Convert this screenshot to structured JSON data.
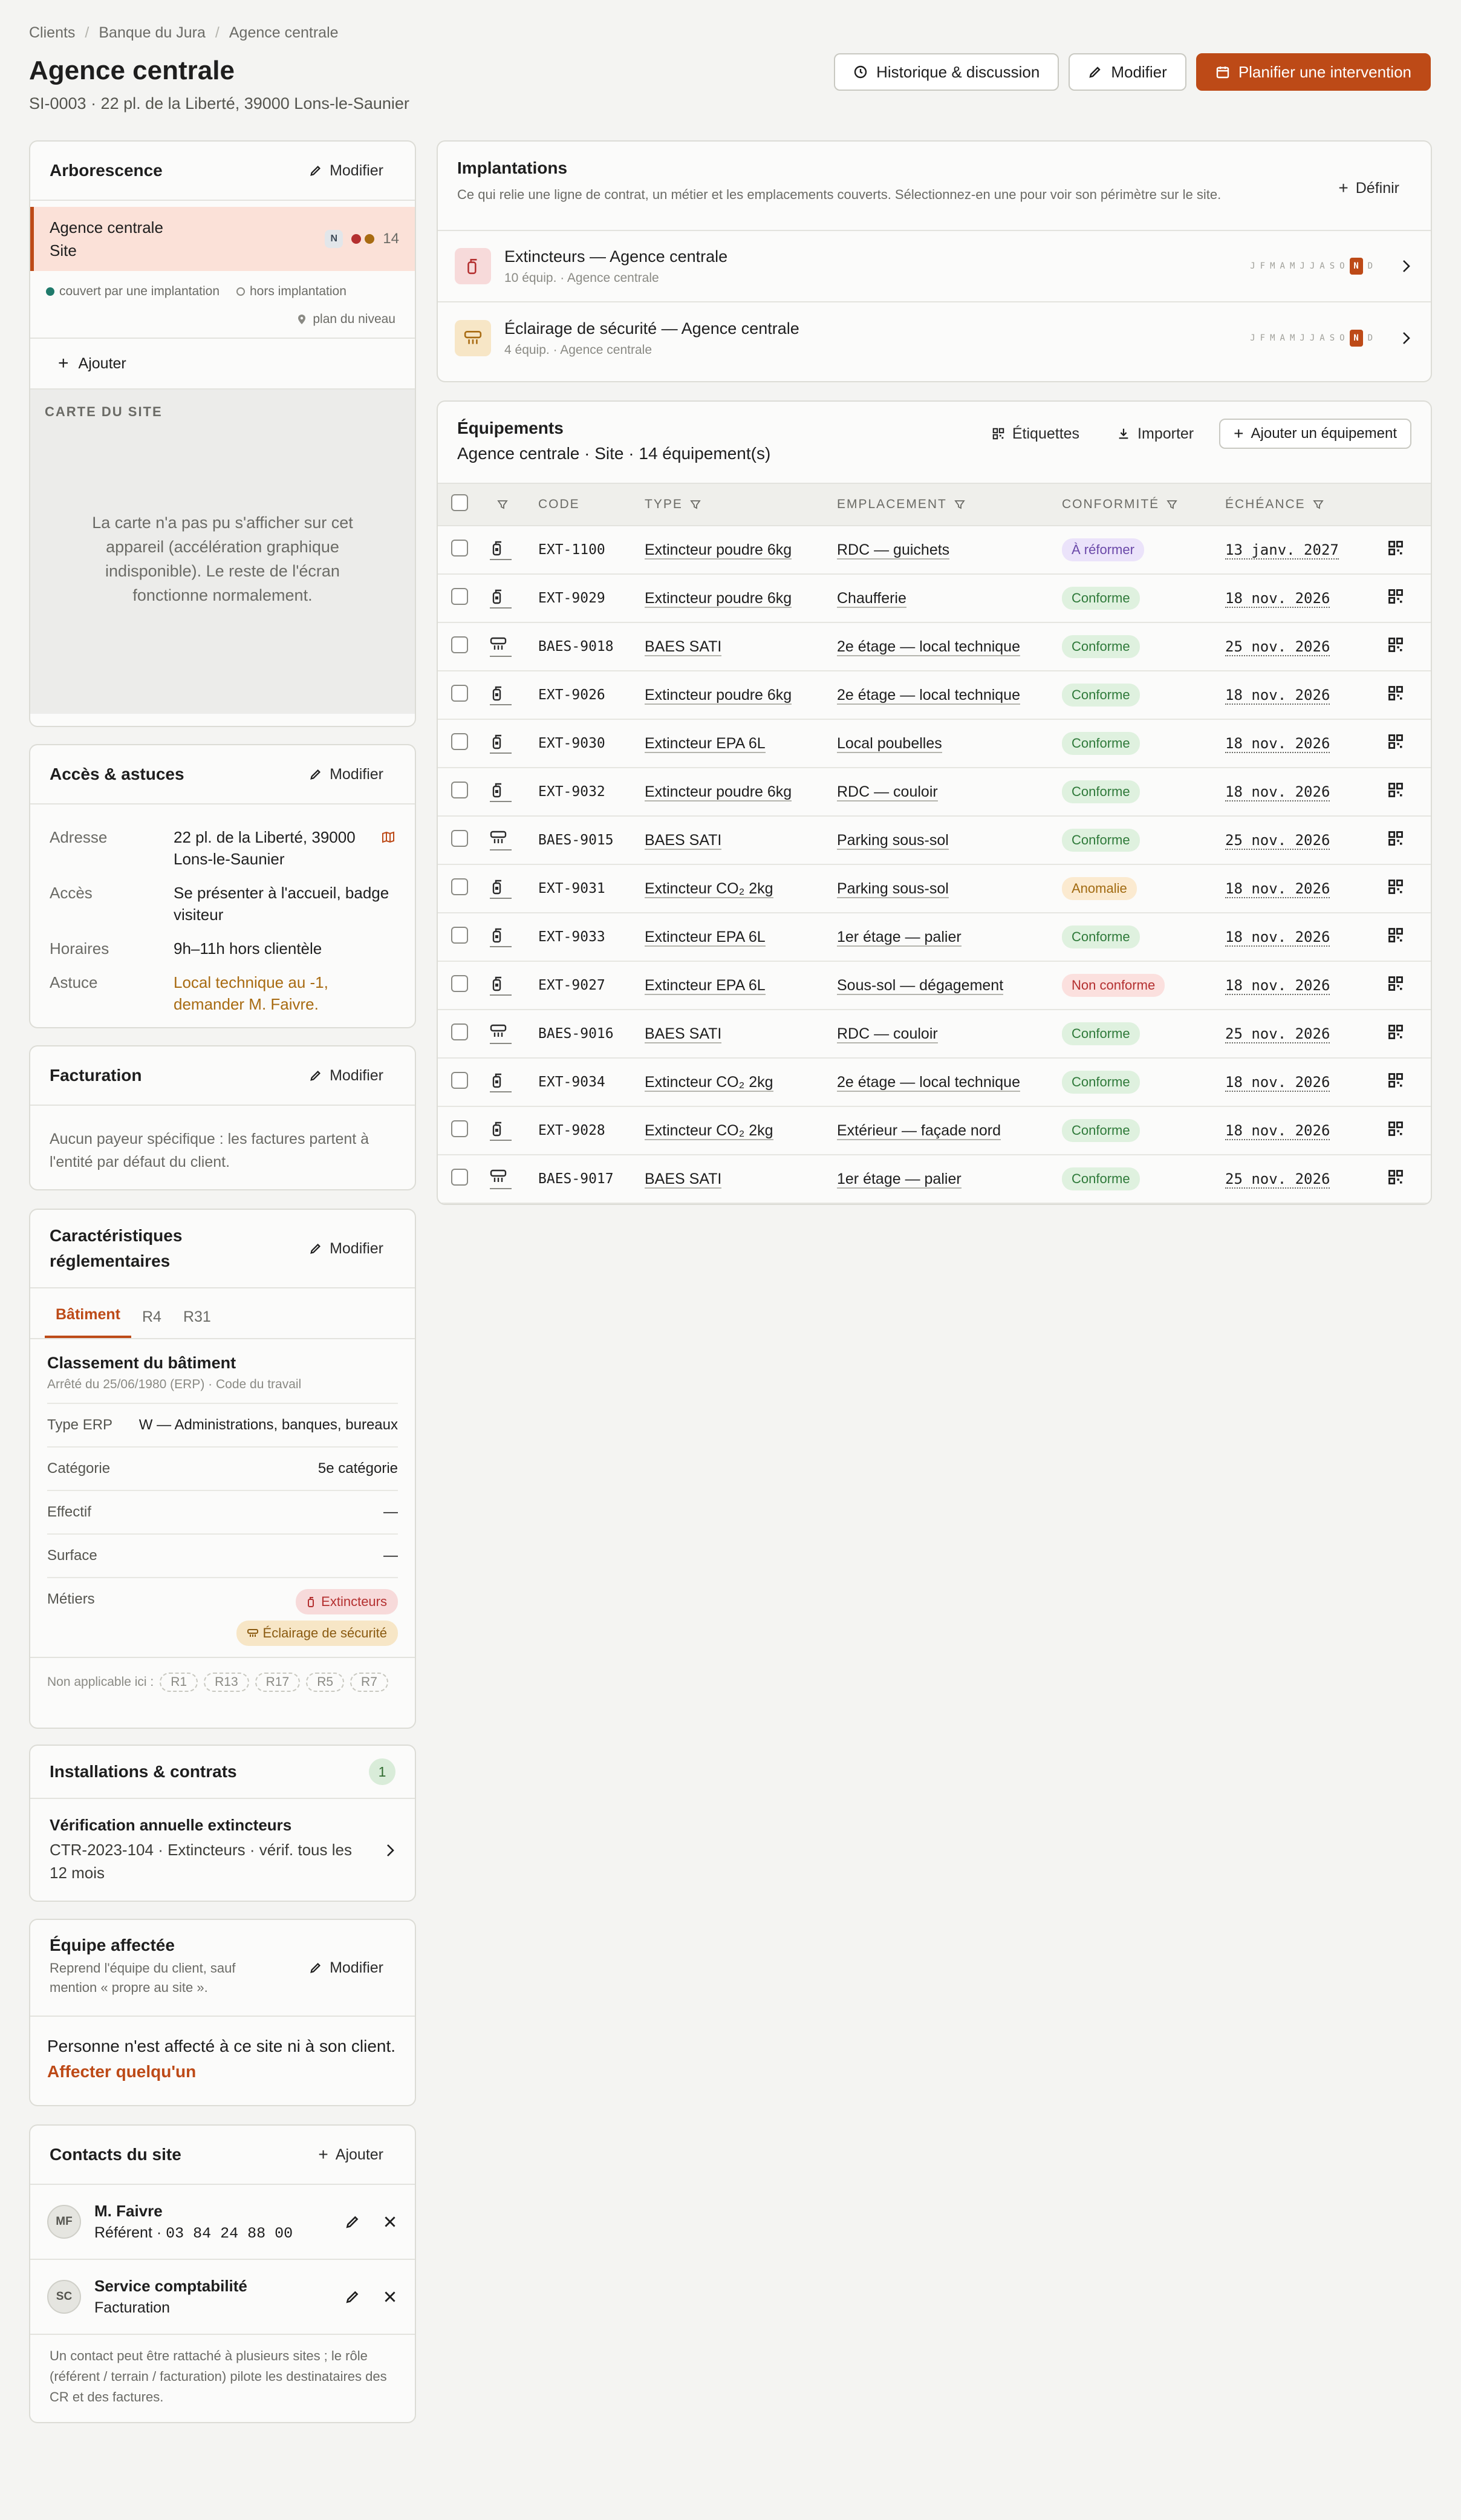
{
  "breadcrumb": [
    "Clients",
    "Banque du Jura",
    "Agence centrale"
  ],
  "header": {
    "title": "Agence centrale",
    "subtitle": "SI-0003 · 22 pl. de la Liberté, 39000 Lons-le-Saunier",
    "history_label": "Historique & discussion",
    "edit_label": "Modifier",
    "plan_label": "Planifier une intervention"
  },
  "tree": {
    "title": "Arborescence",
    "edit_label": "Modifier",
    "item_name": "Agence centrale",
    "item_kind": "Site",
    "item_badge": "N",
    "item_count": "14",
    "legend_covered": "couvert par une implantation",
    "legend_outside": "hors implantation",
    "level_plan": "plan du niveau",
    "add_label": "Ajouter",
    "map_label": "CARTE DU SITE",
    "map_message": "La carte n'a pas pu s'afficher sur cet appareil (accélération graphique indisponible). Le reste de l'écran fonctionne normalement."
  },
  "access": {
    "title": "Accès & astuces",
    "edit_label": "Modifier",
    "rows": [
      {
        "k": "Adresse",
        "v": "22 pl. de la Liberté, 39000 Lons-le-Saunier"
      },
      {
        "k": "Accès",
        "v": "Se présenter à l'accueil, badge visiteur"
      },
      {
        "k": "Horaires",
        "v": "9h–11h hors clientèle"
      },
      {
        "k": "Astuce",
        "v": "Local technique au -1, demander M. Faivre."
      }
    ]
  },
  "billing": {
    "title": "Facturation",
    "edit_label": "Modifier",
    "text": "Aucun payeur spécifique : les factures partent à l'entité par défaut du client."
  },
  "reg": {
    "title": "Caractéristiques réglementaires",
    "edit_label": "Modifier",
    "tabs": [
      "Bâtiment",
      "R4",
      "R31"
    ],
    "section_title": "Classement du bâtiment",
    "section_note": "Arrêté du 25/06/1980 (ERP) · Code du travail",
    "rows": [
      {
        "k": "Type ERP",
        "v": "W — Administrations, banques, bureaux"
      },
      {
        "k": "Catégorie",
        "v": "5e catégorie"
      },
      {
        "k": "Effectif",
        "v": "—"
      },
      {
        "k": "Surface",
        "v": "—"
      }
    ],
    "trades_label": "Métiers",
    "trades": [
      "Extincteurs",
      "Éclairage de sécurité"
    ],
    "na_label": "Non applicable ici :",
    "na_tags": [
      "R1",
      "R13",
      "R17",
      "R5",
      "R7"
    ]
  },
  "install": {
    "title": "Installations & contrats",
    "count": "1",
    "item_title": "Vérification annuelle extincteurs",
    "item_sub": "CTR-2023-104 · Extincteurs · vérif. tous les 12 mois"
  },
  "team": {
    "title": "Équipe affectée",
    "desc": "Reprend l'équipe du client, sauf mention « propre au site ».",
    "edit_label": "Modifier",
    "text": "Personne n'est affecté à ce site ni à son client.",
    "link": "Affecter quelqu'un"
  },
  "contacts": {
    "title": "Contacts du site",
    "add_label": "Ajouter",
    "items": [
      {
        "initials": "MF",
        "name": "M. Faivre",
        "role": "Référent · ",
        "phone": "03 84 24 88 00"
      },
      {
        "initials": "SC",
        "name": "Service comptabilité",
        "role": "Facturation",
        "phone": ""
      }
    ],
    "note": "Un contact peut être rattaché à plusieurs sites ; le rôle (référent / terrain / facturation) pilote les destinataires des CR et des factures."
  },
  "impl": {
    "title": "Implantations",
    "desc": "Ce qui relie une ligne de contrat, un métier et les emplacements couverts. Sélectionnez-en une pour voir son périmètre sur le site.",
    "define_label": "Définir",
    "months": [
      "J",
      "F",
      "M",
      "A",
      "M",
      "J",
      "J",
      "A",
      "S",
      "O",
      "N",
      "D"
    ],
    "items": [
      {
        "title": "Extincteurs — Agence centrale",
        "sub": "10 équip. · Agence centrale",
        "kind": "ext",
        "active_month": 10
      },
      {
        "title": "Éclairage de sécurité — Agence centrale",
        "sub": "4 équip. · Agence centrale",
        "kind": "ecl",
        "active_month": 10
      }
    ]
  },
  "equip": {
    "title": "Équipements",
    "subtitle": "Agence centrale · Site · 14 équipement(s)",
    "labels_btn": "Étiquettes",
    "import_btn": "Importer",
    "add_btn": "Ajouter un équipement",
    "columns": [
      "CODE",
      "TYPE",
      "EMPLACEMENT",
      "CONFORMITÉ",
      "ÉCHÉANCE"
    ],
    "rows": [
      {
        "code": "EXT-1100",
        "type": "Extincteur poudre 6kg",
        "loc": "RDC — guichets",
        "status": "À réformer",
        "st": "reformer",
        "date": "13 janv. 2027",
        "kind": "ext"
      },
      {
        "code": "EXT-9029",
        "type": "Extincteur poudre 6kg",
        "loc": "Chaufferie",
        "status": "Conforme",
        "st": "conforme",
        "date": "18 nov. 2026",
        "kind": "ext"
      },
      {
        "code": "BAES-9018",
        "type": "BAES SATI",
        "loc": "2e étage — local technique",
        "status": "Conforme",
        "st": "conforme",
        "date": "25 nov. 2026",
        "kind": "ecl"
      },
      {
        "code": "EXT-9026",
        "type": "Extincteur poudre 6kg",
        "loc": "2e étage — local technique",
        "status": "Conforme",
        "st": "conforme",
        "date": "18 nov. 2026",
        "kind": "ext"
      },
      {
        "code": "EXT-9030",
        "type": "Extincteur EPA 6L",
        "loc": "Local poubelles",
        "status": "Conforme",
        "st": "conforme",
        "date": "18 nov. 2026",
        "kind": "ext"
      },
      {
        "code": "EXT-9032",
        "type": "Extincteur poudre 6kg",
        "loc": "RDC — couloir",
        "status": "Conforme",
        "st": "conforme",
        "date": "18 nov. 2026",
        "kind": "ext"
      },
      {
        "code": "BAES-9015",
        "type": "BAES SATI",
        "loc": "Parking sous-sol",
        "status": "Conforme",
        "st": "conforme",
        "date": "25 nov. 2026",
        "kind": "ecl"
      },
      {
        "code": "EXT-9031",
        "type": "Extincteur CO₂ 2kg",
        "loc": "Parking sous-sol",
        "status": "Anomalie",
        "st": "anomalie",
        "date": "18 nov. 2026",
        "kind": "ext"
      },
      {
        "code": "EXT-9033",
        "type": "Extincteur EPA 6L",
        "loc": "1er étage — palier",
        "status": "Conforme",
        "st": "conforme",
        "date": "18 nov. 2026",
        "kind": "ext"
      },
      {
        "code": "EXT-9027",
        "type": "Extincteur EPA 6L",
        "loc": "Sous-sol — dégagement",
        "status": "Non conforme",
        "st": "non",
        "date": "18 nov. 2026",
        "kind": "ext"
      },
      {
        "code": "BAES-9016",
        "type": "BAES SATI",
        "loc": "RDC — couloir",
        "status": "Conforme",
        "st": "conforme",
        "date": "25 nov. 2026",
        "kind": "ecl"
      },
      {
        "code": "EXT-9034",
        "type": "Extincteur CO₂ 2kg",
        "loc": "2e étage — local technique",
        "status": "Conforme",
        "st": "conforme",
        "date": "18 nov. 2026",
        "kind": "ext"
      },
      {
        "code": "EXT-9028",
        "type": "Extincteur CO₂ 2kg",
        "loc": "Extérieur — façade nord",
        "status": "Conforme",
        "st": "conforme",
        "date": "18 nov. 2026",
        "kind": "ext"
      },
      {
        "code": "BAES-9017",
        "type": "BAES SATI",
        "loc": "1er étage — palier",
        "status": "Conforme",
        "st": "conforme",
        "date": "25 nov. 2026",
        "kind": "ecl"
      }
    ]
  },
  "colors": {
    "accent": "#bd4a17",
    "covered": "#1f7a6b",
    "extinct": "#b43030",
    "eclair": "#a86b12"
  }
}
